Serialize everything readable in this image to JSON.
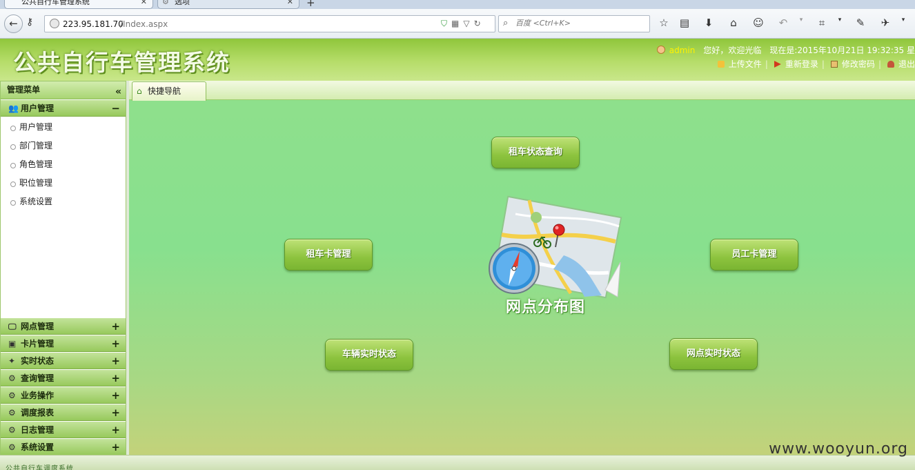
{
  "browser": {
    "tabs": [
      {
        "title": "公共自行车管理系统",
        "active": true
      },
      {
        "title": "选项",
        "active": false
      }
    ],
    "url_host": "223.95.181.70",
    "url_path": "/Index.aspx",
    "search_placeholder": "百度 <Ctrl+K>"
  },
  "header": {
    "title": "公共自行车管理系统",
    "username": "admin",
    "welcome": "您好，欢迎光临",
    "datetime": "现在是:2015年10月21日 19:32:35 星",
    "links": {
      "upload": "上传文件",
      "relogin": "重新登录",
      "change_password": "修改密码",
      "logout": "退出"
    }
  },
  "sidebar": {
    "title": "管理菜单",
    "open_group": {
      "label": "用户管理",
      "items": [
        "用户管理",
        "部门管理",
        "角色管理",
        "职位管理",
        "系统设置"
      ]
    },
    "groups": [
      "网点管理",
      "卡片管理",
      "实时状态",
      "查询管理",
      "业务操作",
      "调度报表",
      "日志管理",
      "系统设置"
    ]
  },
  "main": {
    "tab_label": "快捷导航",
    "buttons": {
      "rental_status": "租车状态查询",
      "rental_card": "租车卡管理",
      "staff_card": "员工卡管理",
      "vehicle_status": "车辆实时状态",
      "station_status": "网点实时状态"
    },
    "map_label": "网点分布图"
  },
  "footer": {
    "text": "公共自行车调度系统"
  },
  "watermark": "www.wooyun.org",
  "colors": {
    "accent_green": "#8cc33e",
    "header_yellow": "#fff200"
  }
}
